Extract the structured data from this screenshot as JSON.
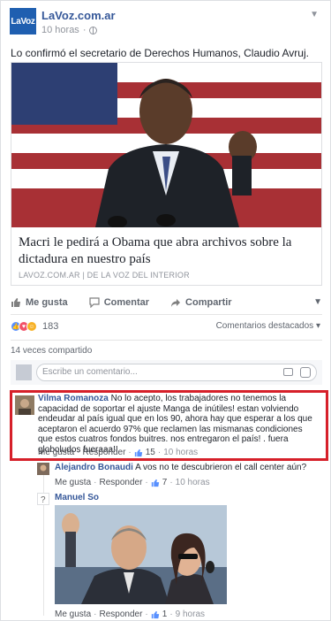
{
  "source": {
    "logo_text": "LaVoz",
    "name": "LaVoz.com.ar",
    "time": "10 horas"
  },
  "post": {
    "text": "Lo confirmó el secretario de Derechos Humanos, Claudio Avruj."
  },
  "link": {
    "headline": "Macri le pedirá a Obama que abra archivos sobre la dictadura en nuestro país",
    "caption": "LAVOZ.COM.AR | DE LA VOZ DEL INTERIOR"
  },
  "actions": {
    "like": "Me gusta",
    "comment": "Comentar",
    "share": "Compartir"
  },
  "reactions": {
    "count": "183",
    "sort": "Comentarios destacados"
  },
  "shares": "14 veces compartido",
  "composer": {
    "placeholder": "Escribe un comentario..."
  },
  "comments": [
    {
      "author": "Vilma Romanoza",
      "text": "No lo acepto, los trabajadores no tenemos la capacidad de soportar el ajuste Manga de inútiles! estan volviendo endeudar al país igual que en los 90, ahora hay que esperar a los que aceptaron el acuerdo 97% que reclamen las mismanas condiciones que estos cuatros fondos buitres. nos entregaron el país! . fuera globoludos fueraaa!!",
      "like": "Me gusta",
      "reply": "Responder",
      "likes": "15",
      "time": "10 horas"
    },
    {
      "author": "Alejandro Bonaudi",
      "text": "A vos no te descubrieron el call center aún?",
      "like": "Me gusta",
      "reply": "Responder",
      "likes": "7",
      "time": "10 horas"
    },
    {
      "author": "Manuel So",
      "like": "Me gusta",
      "reply": "Responder",
      "likes": "1",
      "time": "9 horas"
    }
  ],
  "colors": {
    "link_blue": "#365899",
    "highlight_red": "#d6202a",
    "brand_blue": "#1f5fb0"
  }
}
